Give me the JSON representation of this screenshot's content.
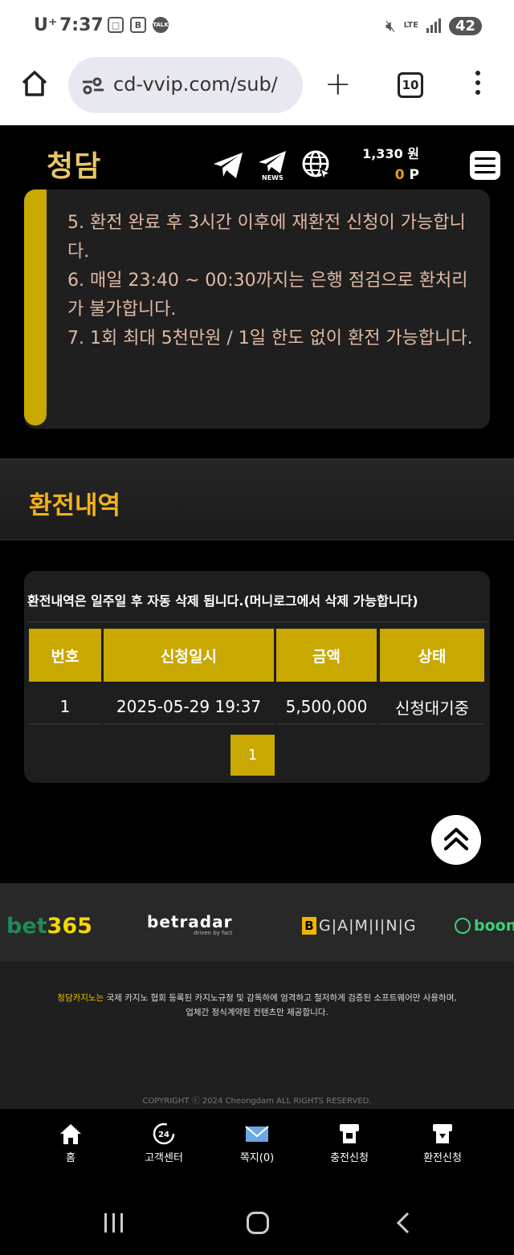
{
  "status_bar": {
    "carrier": "U⁺",
    "time": "7:37",
    "lte": "LTE",
    "battery": "42"
  },
  "browser": {
    "url": "cd-vvip.com/sub/",
    "tab_count": "10"
  },
  "header": {
    "logo": "청담",
    "news_label": "NEWS",
    "balance_won": "1,330 원",
    "points_value": "0",
    "points_unit": "P"
  },
  "notice": {
    "lines": [
      "5. 환전 완료 후 3시간 이후에 재환전 신청이 가능합니다.",
      "6. 매일 23:40 ~ 00:30까지는 은행 점검으로 환처리가 불가합니다.",
      "7. 1회 최대 5천만원 / 1일 한도 없이 환전 가능합니다."
    ]
  },
  "section": {
    "title": "환전내역"
  },
  "history": {
    "message": "환전내역은 일주일 후 자동 삭제 됩니다.(머니로그에서 삭제 가능합니다)",
    "columns": [
      "번호",
      "신청일시",
      "금액",
      "상태"
    ],
    "rows": [
      [
        "1",
        "2025-05-29 19:37",
        "5,500,000",
        "신청대기중"
      ]
    ],
    "page": "1"
  },
  "providers": {
    "bet365_a": "bet",
    "bet365_b": "365",
    "betradar": "betradar",
    "betradar_sub": "driven by fact",
    "bgaming_first": "B",
    "bgaming_rest": "G|A|M|I|N|G",
    "booongo": "boon"
  },
  "footer": {
    "brand": "청담카지노는",
    "desc_line1": " 국제 카지노 협회 등록된 카지노규정 및 감독하에 엄격하고 철저하게 검증된 소프트웨어만 사용하며,",
    "desc_line2": "업체간 정식계약된 컨텐츠만 제공합니다.",
    "copyright": "COPYRIGHT ⓒ 2024 Cheongdam ALL RIGHTS RESERVED."
  },
  "bottom_nav": {
    "home": "홈",
    "support": "고객센터",
    "messages": "쪽지(0)",
    "deposit": "충전신청",
    "withdraw": "환전신청"
  },
  "colors": {
    "accent_gold": "#c9a800",
    "title_gold": "#f2b11a",
    "notice_text": "#e0b9a5"
  }
}
